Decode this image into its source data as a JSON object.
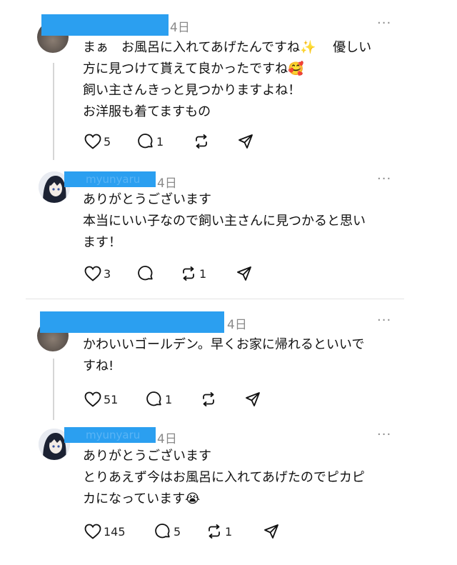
{
  "posts": [
    {
      "time": "4日",
      "more": "···",
      "lines": [
        "まぁ　お風呂に入れてあげたんですね✨　 優しい",
        "方に見つけて貰えて良かったですね🥰",
        "飼い主さんきっと見つかりますよね！",
        "お洋服も着てますもの"
      ],
      "likes": "5",
      "replies": "1",
      "reposts": ""
    },
    {
      "username": "myunyaru",
      "time": "4日",
      "more": "···",
      "lines": [
        "ありがとうございます",
        "本当にいい子なので飼い主さんに見つかると思い",
        "ます！"
      ],
      "likes": "3",
      "replies": "",
      "reposts": "1"
    },
    {
      "time": "4日",
      "more": "···",
      "lines": [
        "かわいいゴールデン。早くお家に帰れるといいで",
        "すね!"
      ],
      "likes": "51",
      "replies": "1",
      "reposts": ""
    },
    {
      "username": "myunyaru",
      "time": "4日",
      "more": "···",
      "lines": [
        "ありがとうございます",
        "とりあえず今はお風呂に入れてあげたのでピカピ",
        "カになっています😭"
      ],
      "likes": "145",
      "replies": "5",
      "reposts": "1"
    }
  ],
  "icons": {
    "like": "heart-icon",
    "reply": "comment-icon",
    "repost": "repost-icon",
    "share": "share-icon"
  }
}
